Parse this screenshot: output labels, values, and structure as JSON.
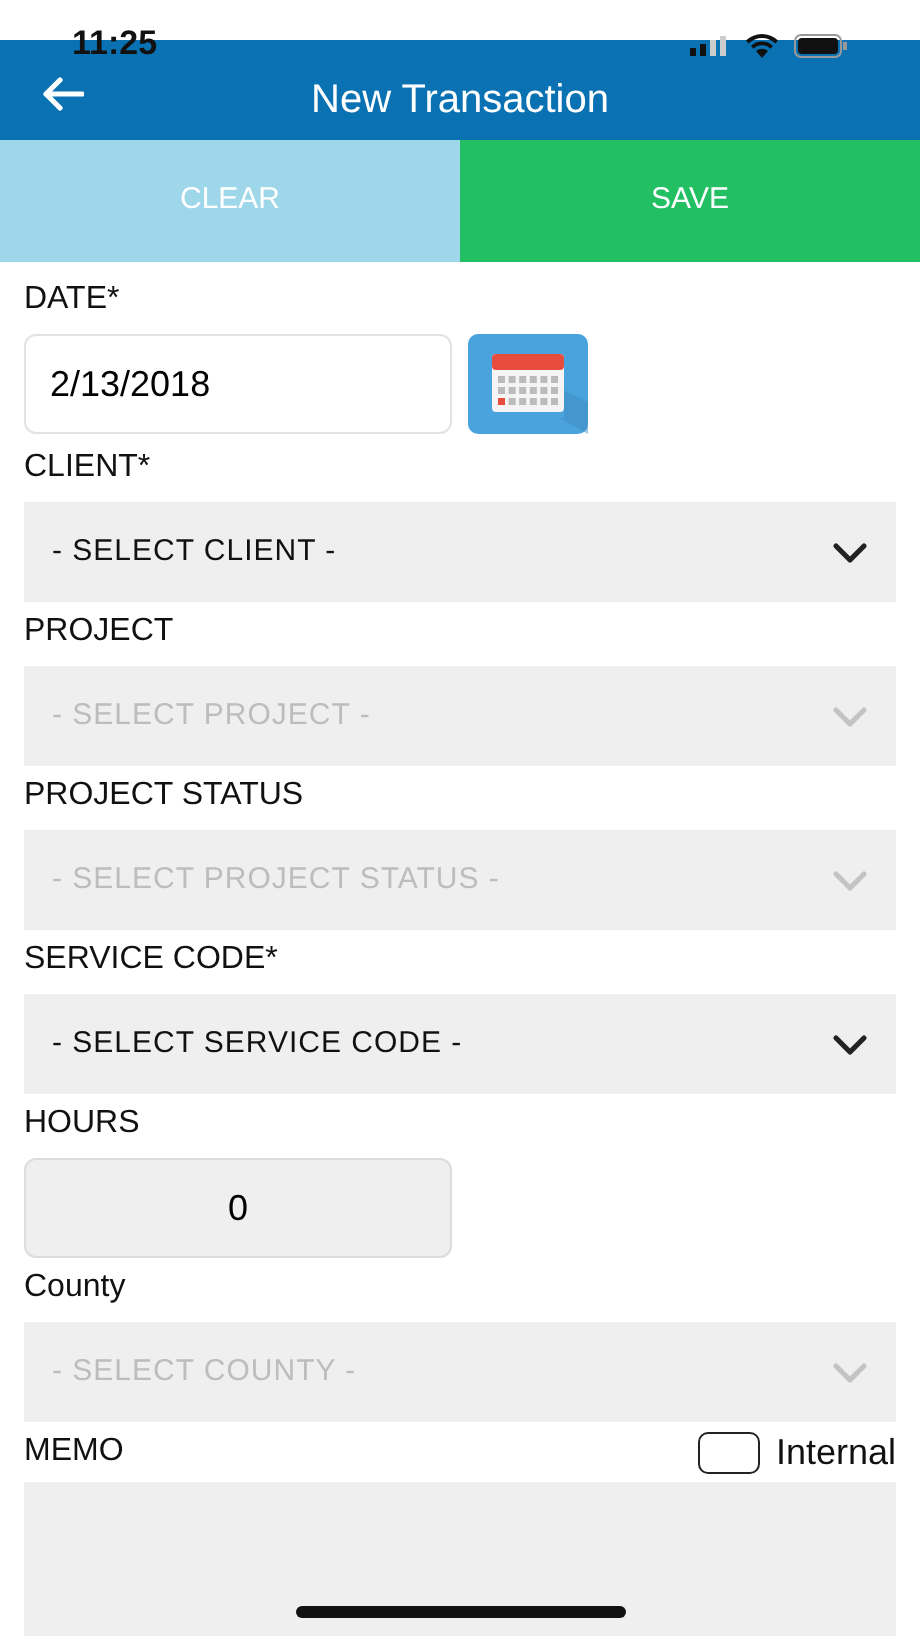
{
  "status_bar": {
    "time": "11:25"
  },
  "header": {
    "title": "New Transaction"
  },
  "actions": [
    {
      "label": "CLEAR",
      "kind": "clear"
    },
    {
      "label": "SAVE",
      "kind": "save"
    }
  ],
  "fields": [
    {
      "kind": "date",
      "label": "DATE*",
      "value": "2/13/2018"
    },
    {
      "kind": "select",
      "label": "CLIENT*",
      "placeholder": "- SELECT CLIENT -",
      "disabled": false
    },
    {
      "kind": "select",
      "label": "PROJECT",
      "placeholder": "- SELECT PROJECT -",
      "disabled": true
    },
    {
      "kind": "select",
      "label": "PROJECT STATUS",
      "placeholder": "- SELECT PROJECT STATUS -",
      "disabled": true
    },
    {
      "kind": "select",
      "label": "SERVICE CODE*",
      "placeholder": "- SELECT SERVICE CODE -",
      "disabled": false
    },
    {
      "kind": "number",
      "label": "HOURS",
      "value": "0"
    },
    {
      "kind": "select",
      "label": "County",
      "placeholder": "- SELECT COUNTY -",
      "disabled": true
    },
    {
      "kind": "memo",
      "label": "MEMO",
      "internal": {
        "label": "Internal",
        "checked": false
      }
    }
  ]
}
